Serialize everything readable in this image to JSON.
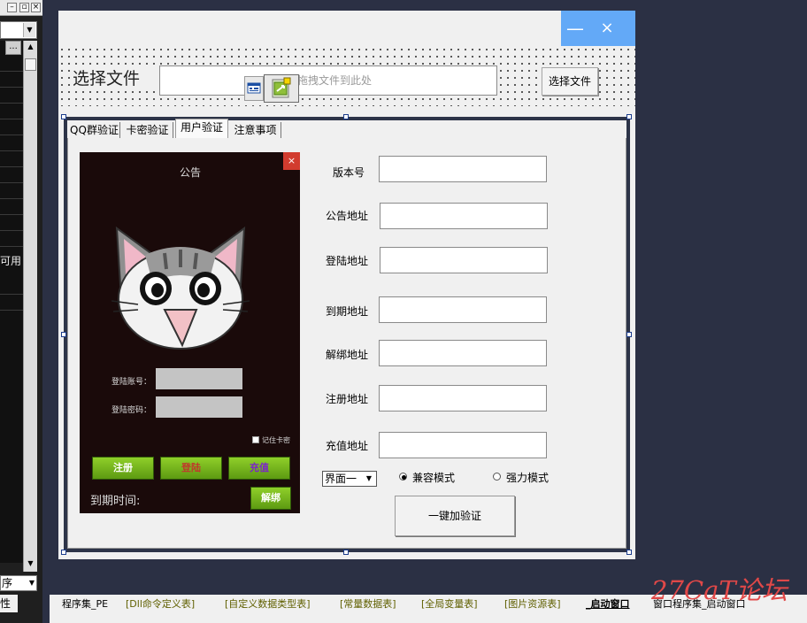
{
  "left_panel": {
    "usable_text": "可用",
    "bottom_combo": "序",
    "bottom_tab": "性",
    "ellipsis": "...",
    "close_glyph": "×"
  },
  "window": {
    "minimize_glyph": "—",
    "close_glyph": "×"
  },
  "file_row": {
    "label": "选择文件",
    "placeholder": "拖拽文件到此处",
    "button": "选择文件"
  },
  "tabs": [
    "QQ群验证",
    "卡密验证",
    "用户验证",
    "注意事项"
  ],
  "active_tab": 2,
  "phone": {
    "title": "公告",
    "close": "×",
    "account_label": "登陆账号：",
    "password_label": "登陆密码：",
    "remember": "记住卡密",
    "register": "注册",
    "login": "登陆",
    "recharge": "充值",
    "expire": "到期时间:",
    "unbind": "解绑"
  },
  "form": {
    "fields": [
      "版本号",
      "公告地址",
      "登陆地址",
      "到期地址",
      "解绑地址",
      "注册地址",
      "充值地址"
    ],
    "combo": "界面一",
    "radio_compat": "兼容模式",
    "radio_strong": "强力模式",
    "oneclick": "一键加验证"
  },
  "bottom_tabs": [
    "程序集_PE",
    "[Dll命令定义表]",
    "[自定义数据类型表]",
    "[常量数据表]",
    "[全局变量表]",
    "[图片资源表]",
    "_启动窗口",
    "窗口程序集_启动窗口"
  ],
  "watermark": "27CaT论坛",
  "colors": {
    "accent": "#63a9f7",
    "green_button": "#6fae1a",
    "phone_bg": "#1a0a0a"
  }
}
